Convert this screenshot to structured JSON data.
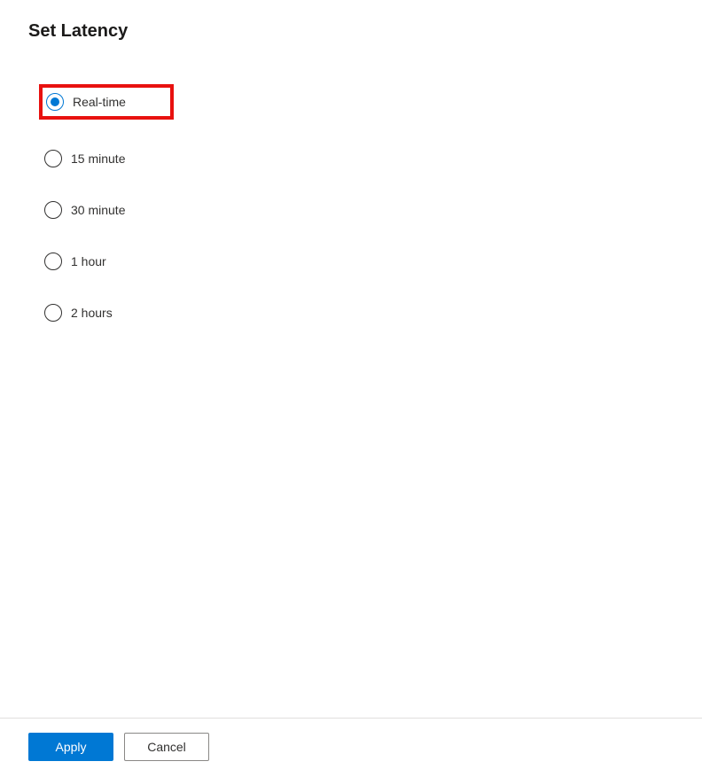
{
  "title": "Set Latency",
  "options": [
    {
      "label": "Real-time",
      "selected": true,
      "highlighted": true
    },
    {
      "label": "15 minute",
      "selected": false,
      "highlighted": false
    },
    {
      "label": "30 minute",
      "selected": false,
      "highlighted": false
    },
    {
      "label": "1 hour",
      "selected": false,
      "highlighted": false
    },
    {
      "label": "2 hours",
      "selected": false,
      "highlighted": false
    }
  ],
  "buttons": {
    "apply": "Apply",
    "cancel": "Cancel"
  },
  "colors": {
    "accent": "#0078d4",
    "highlight_border": "#e8110f"
  }
}
